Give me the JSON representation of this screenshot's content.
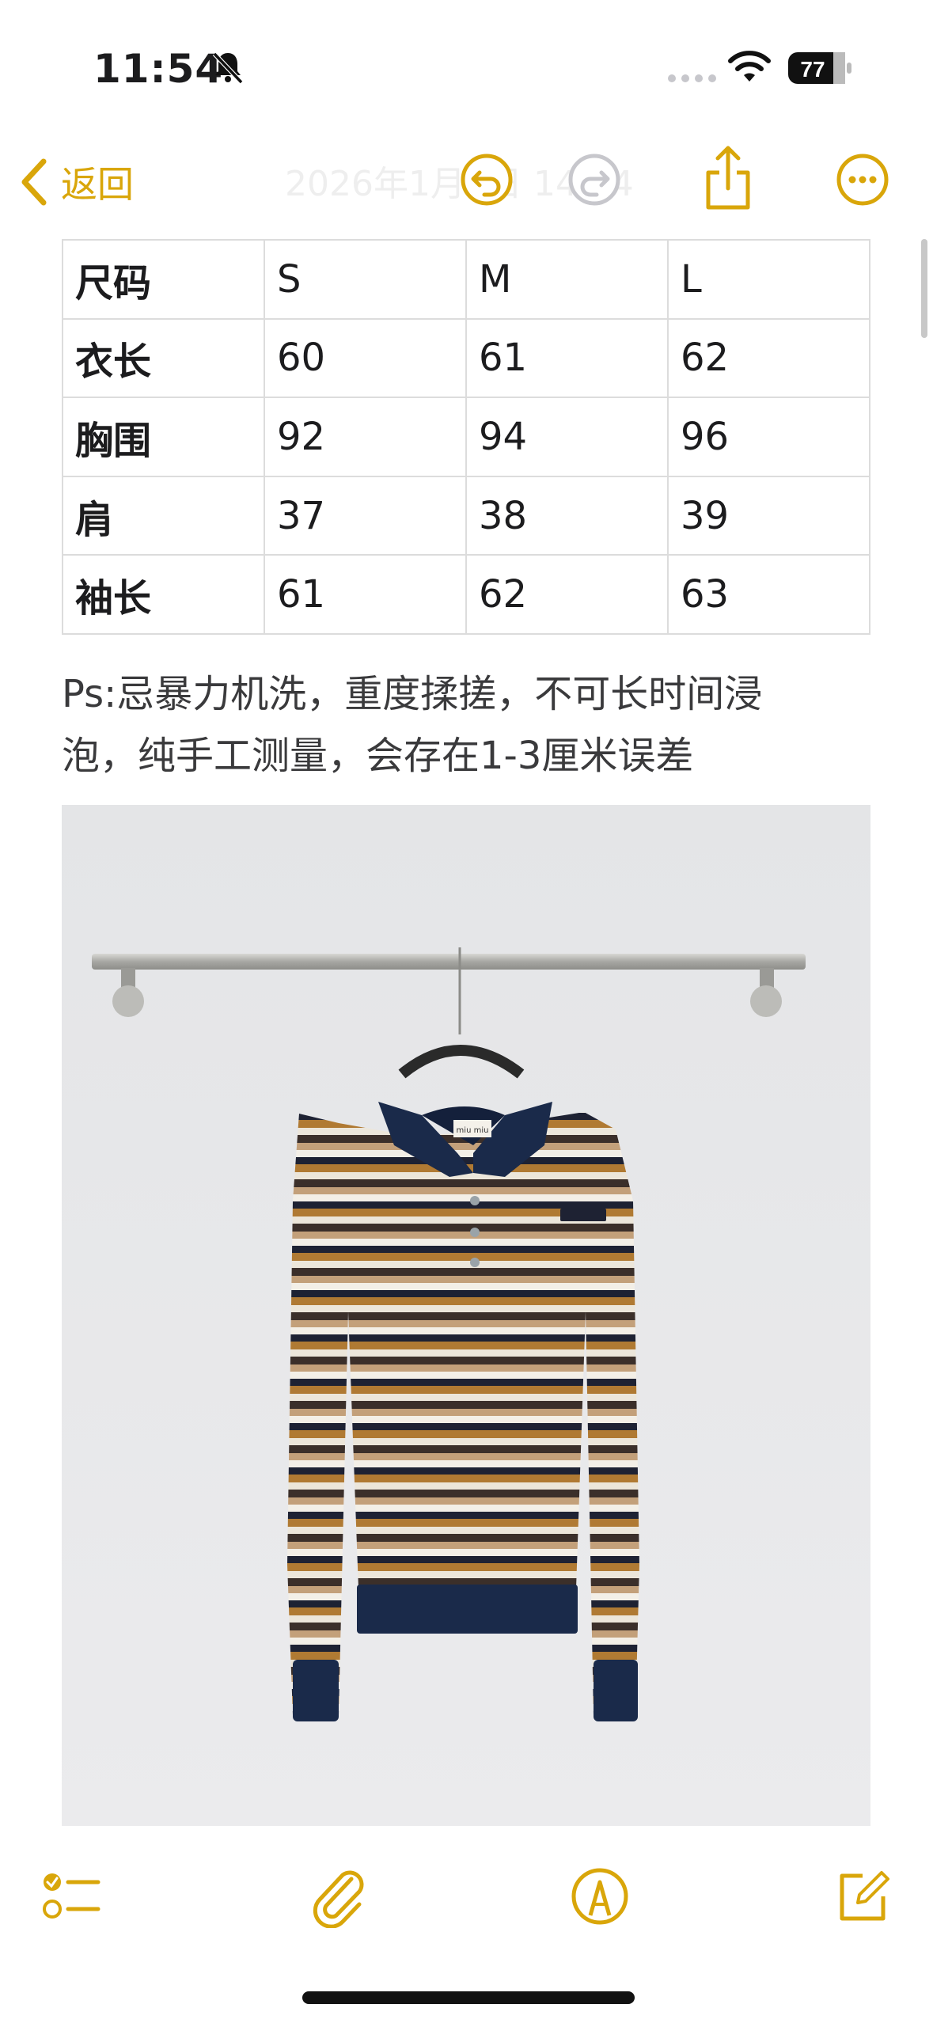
{
  "status_bar": {
    "time": "11:54",
    "battery": "77"
  },
  "nav": {
    "back_label": "返回",
    "title": "2026年1月5日 14:14"
  },
  "table": {
    "header": [
      "尺码",
      "S",
      "M",
      "L"
    ],
    "rows": [
      [
        "衣长",
        "60",
        "61",
        "62"
      ],
      [
        "胸围",
        "92",
        "94",
        "96"
      ],
      [
        "肩",
        "37",
        "38",
        "39"
      ],
      [
        "袖长",
        "61",
        "62",
        "63"
      ]
    ]
  },
  "note": {
    "line1": "Ps:忌暴力机洗，重度揉搓，不可长时间浸",
    "line2": "泡，纯手工测量，会存在1-3厘米误差"
  },
  "photo": {
    "label_text": "miu miu"
  },
  "colors": {
    "accent": "#d9a60a",
    "navy": "#1a2a4a",
    "tan": "#b07a33"
  },
  "toolbar": {
    "icons": [
      "checklist-icon",
      "paperclip-icon",
      "markup-pen-icon",
      "compose-icon"
    ]
  }
}
